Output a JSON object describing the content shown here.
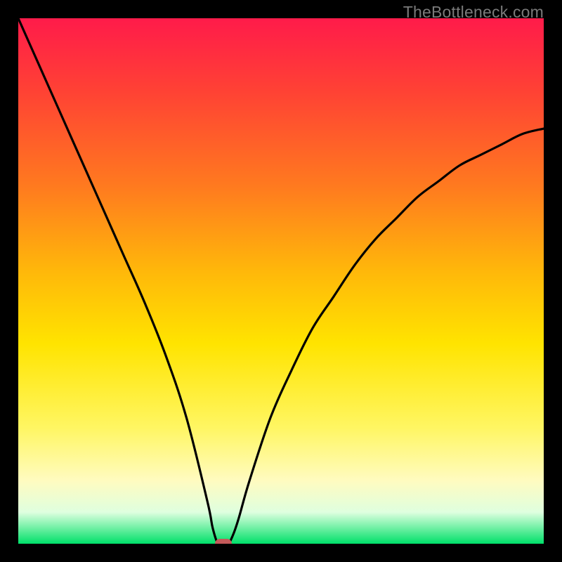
{
  "watermark_text": "TheBottleneck.com",
  "colors": {
    "frame": "#000000",
    "curve": "#000000",
    "marker": "#c45a5a",
    "gradient_top": "#ff1b4a",
    "gradient_bottom": "#00e069"
  },
  "chart_data": {
    "type": "line",
    "title": "",
    "xlabel": "",
    "ylabel": "",
    "xlim": [
      0,
      100
    ],
    "ylim": [
      0,
      100
    ],
    "x": [
      0,
      4,
      8,
      12,
      16,
      20,
      24,
      28,
      32,
      36,
      37,
      38,
      39,
      40,
      41,
      42,
      44,
      48,
      52,
      56,
      60,
      64,
      68,
      72,
      76,
      80,
      84,
      88,
      92,
      96,
      100
    ],
    "values": [
      100,
      91,
      82,
      73,
      64,
      55,
      46,
      36,
      24,
      8,
      3,
      0,
      0,
      0,
      2,
      5,
      12,
      24,
      33,
      41,
      47,
      53,
      58,
      62,
      66,
      69,
      72,
      74,
      76,
      78,
      79
    ],
    "marker": {
      "x": 39,
      "y": 0
    },
    "annotations": []
  }
}
